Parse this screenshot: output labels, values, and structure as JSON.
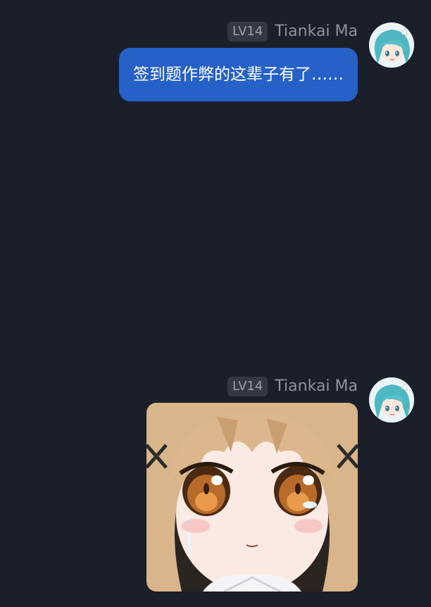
{
  "messages": [
    {
      "level": "LV14",
      "sender": "Tiankai Ma",
      "type": "text",
      "text": "签到题作弊的这辈子有了……"
    },
    {
      "level": "LV14",
      "sender": "Tiankai Ma",
      "type": "sticker",
      "sticker": "crying-anime-girl-sticker"
    }
  ],
  "colors": {
    "background": "#1b1f2a",
    "bubble": "#2561c7",
    "badge": "#343844"
  }
}
